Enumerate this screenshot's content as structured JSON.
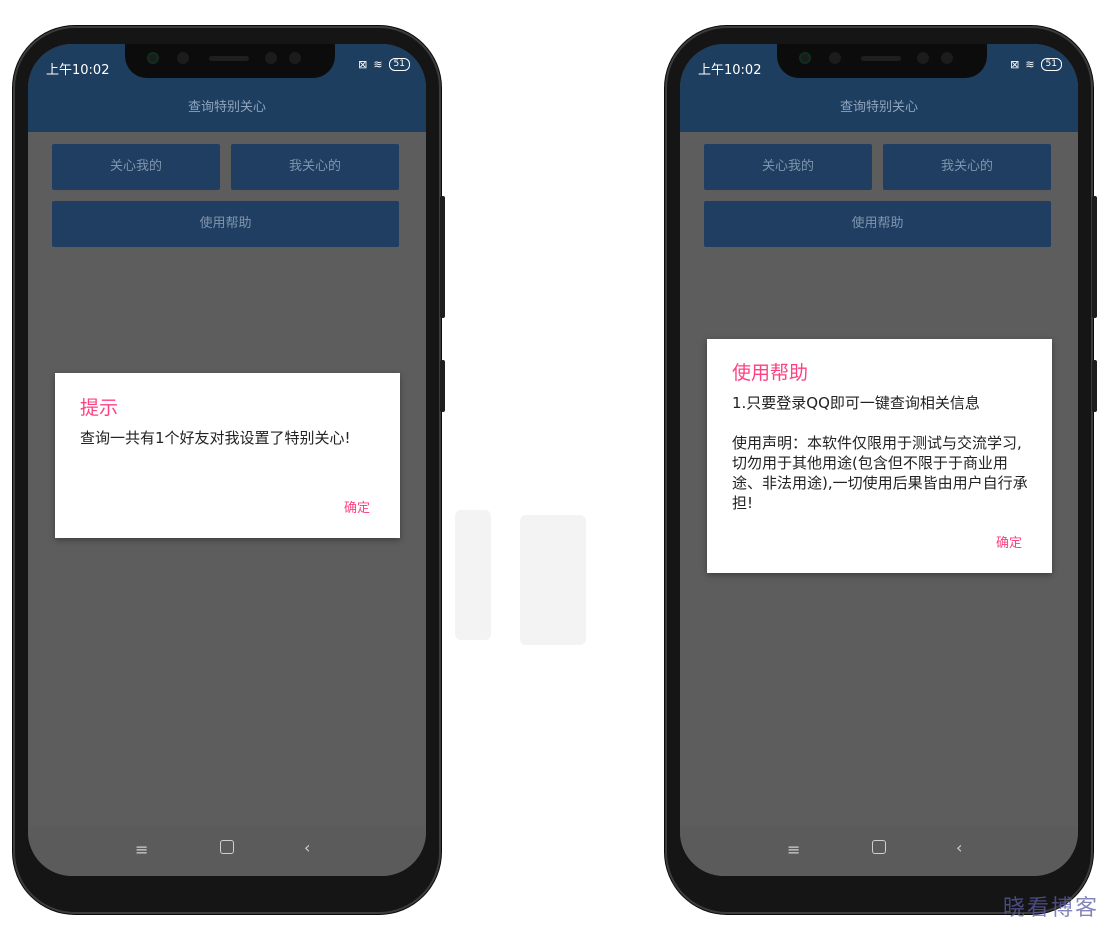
{
  "status": {
    "time": "上午10:02",
    "battery": "51"
  },
  "app": {
    "title": "查询特别关心",
    "buttons": {
      "care_me": "关心我的",
      "i_care": "我关心的",
      "help": "使用帮助"
    }
  },
  "dialog_left": {
    "title": "提示",
    "message": "查询一共有1个好友对我设置了特别关心!",
    "ok": "确定"
  },
  "dialog_right": {
    "title": "使用帮助",
    "line1": "1.只要登录QQ即可一键查询相关信息",
    "line2": "使用声明：本软件仅限用于测试与交流学习,切勿用于其他用途(包含但不限于于商业用途、非法用途),一切使用后果皆由用户自行承担!",
    "ok": "确定"
  },
  "nav": {
    "menu": "≡",
    "back": "‹"
  },
  "watermark": "晓看博客",
  "icons": [
    "sim-icon",
    "wifi-icon",
    "battery-icon",
    "menu-icon",
    "home-icon",
    "back-icon"
  ]
}
